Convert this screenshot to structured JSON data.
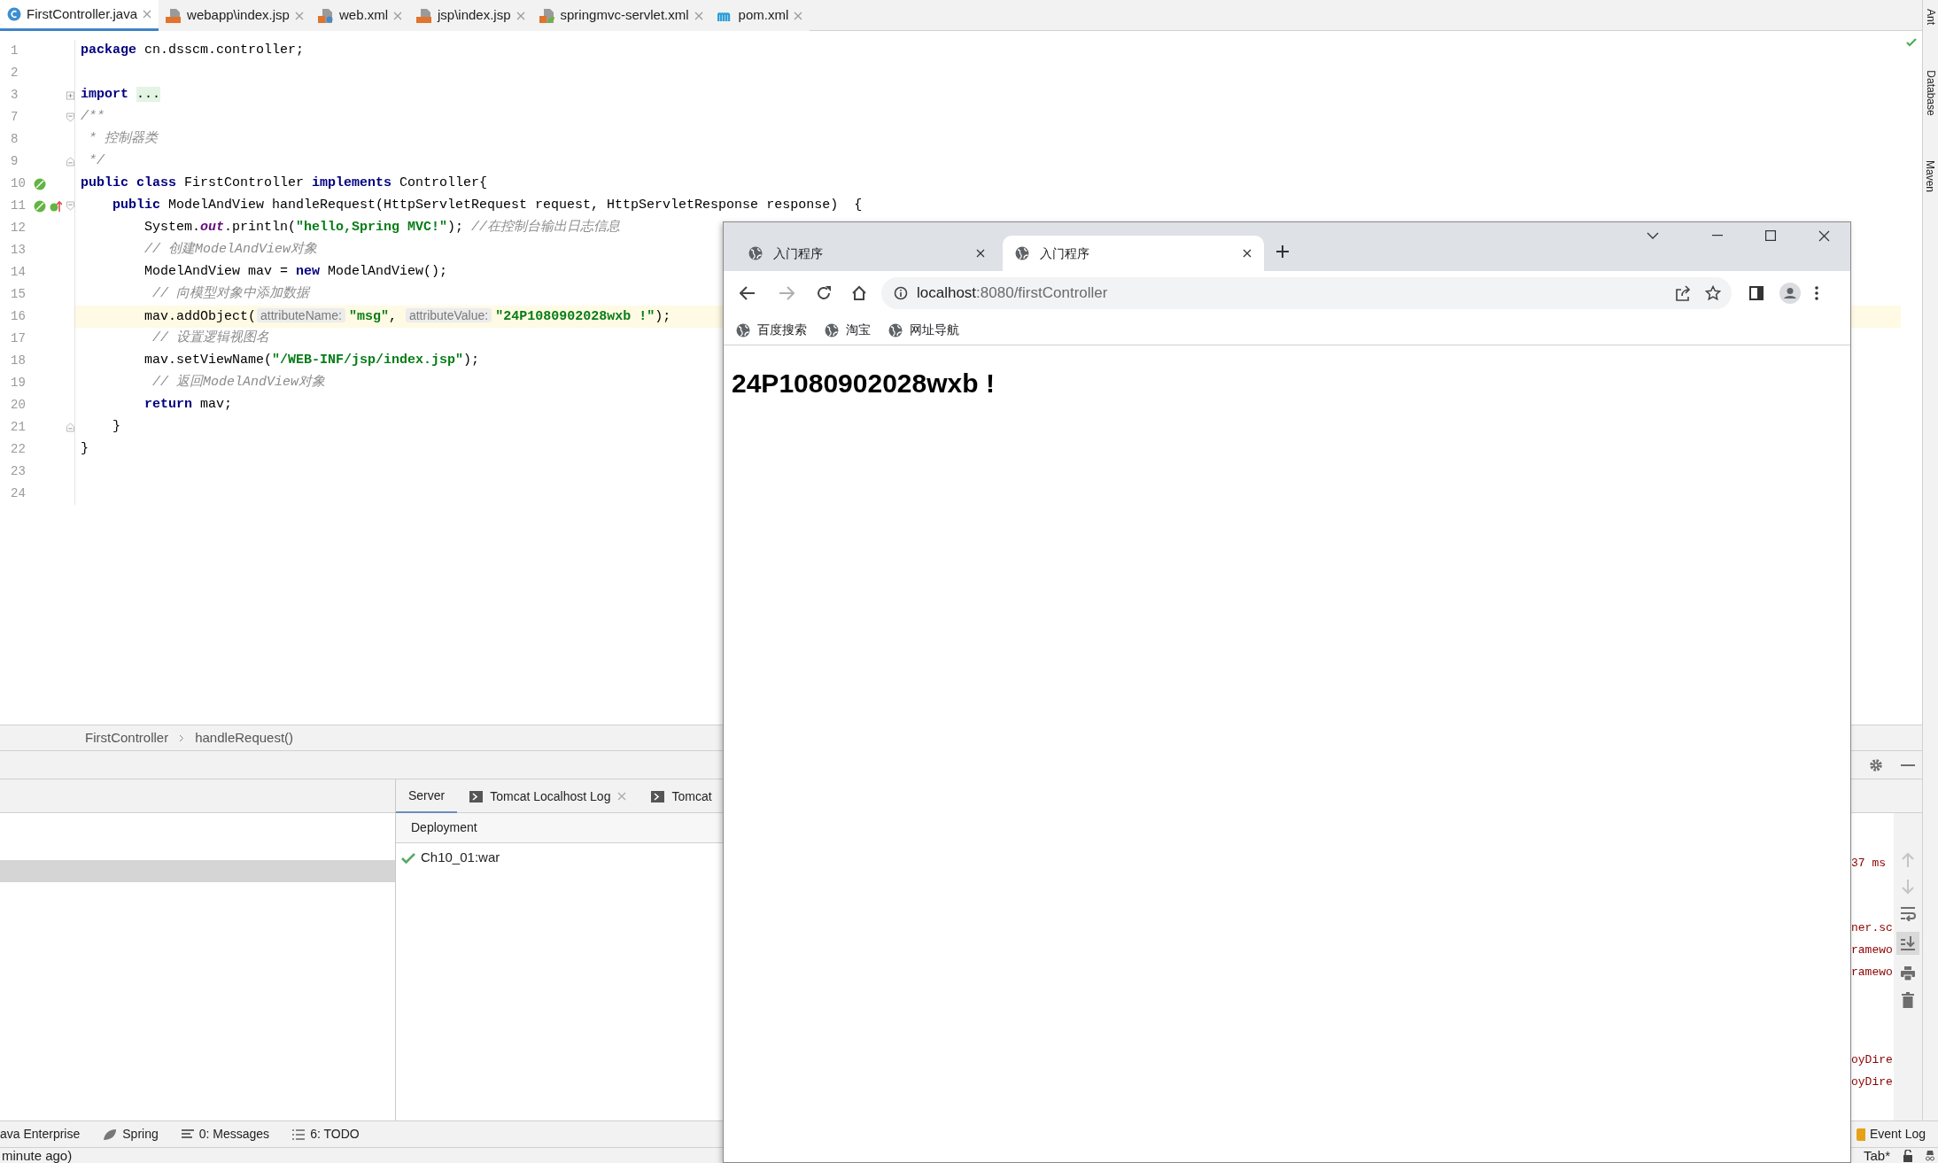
{
  "editor_tabs": [
    {
      "label": "FirstController.java",
      "kind": "class",
      "selected": true
    },
    {
      "label": "webapp\\index.jsp",
      "kind": "jsp",
      "selected": false
    },
    {
      "label": "web.xml",
      "kind": "xml",
      "selected": false
    },
    {
      "label": "jsp\\index.jsp",
      "kind": "jsp",
      "selected": false
    },
    {
      "label": "springmvc-servlet.xml",
      "kind": "spring_xml",
      "selected": false
    },
    {
      "label": "pom.xml",
      "kind": "maven",
      "selected": false
    }
  ],
  "code_lines": [
    {
      "number": "1",
      "current": false,
      "tokens": [
        {
          "kind": "kw",
          "text": "package"
        },
        {
          "kind": "plain",
          "text": " cn.dsscm.controller;"
        }
      ]
    },
    {
      "number": "2",
      "current": false
    },
    {
      "number": "3",
      "current": false,
      "fold": {
        "kind": "collapsed"
      },
      "tokens": [
        {
          "kind": "kw",
          "text": "import"
        },
        {
          "kind": "folded",
          "text": "..."
        }
      ]
    },
    {
      "number": "7",
      "current": false,
      "fold": {
        "kind": "start"
      },
      "tokens": [
        {
          "kind": "cmt",
          "text": "/**"
        }
      ]
    },
    {
      "number": "8",
      "current": false,
      "tokens": [
        {
          "kind": "cmt",
          "text": " * 控制器类"
        }
      ]
    },
    {
      "number": "9",
      "current": false,
      "fold": {
        "kind": "end"
      },
      "tokens": [
        {
          "kind": "cmt",
          "text": " */"
        }
      ]
    },
    {
      "number": "10",
      "current": false,
      "gutter": [
        {
          "kind": "bean"
        }
      ],
      "tokens": [
        {
          "kind": "kw",
          "text": "public class"
        },
        {
          "kind": "plain",
          "text": " FirstController "
        },
        {
          "kind": "kw",
          "text": "implements"
        },
        {
          "kind": "plain",
          "text": " Controller{"
        }
      ]
    },
    {
      "number": "11",
      "current": false,
      "gutter": [
        {
          "kind": "bean"
        },
        {
          "kind": "override"
        }
      ],
      "fold": {
        "kind": "start"
      },
      "tokens": [
        {
          "kind": "kw",
          "text": "    public"
        },
        {
          "kind": "plain",
          "text": " ModelAndView handleRequest(HttpServletRequest request, HttpServletResponse response)  {"
        }
      ]
    },
    {
      "number": "12",
      "current": false,
      "tokens": [
        {
          "kind": "plain",
          "text": "        System."
        },
        {
          "kind": "field",
          "text": "out"
        },
        {
          "kind": "plain",
          "text": ".println("
        },
        {
          "kind": "str",
          "text": "\"hello,Spring MVC!\""
        },
        {
          "kind": "plain",
          "text": "); "
        },
        {
          "kind": "cmt",
          "text": "//在控制台输出日志信息"
        }
      ]
    },
    {
      "number": "13",
      "current": false,
      "tokens": [
        {
          "kind": "cmt",
          "text": "        // 创建ModelAndView对象"
        }
      ]
    },
    {
      "number": "14",
      "current": false,
      "tokens": [
        {
          "kind": "plain",
          "text": "        ModelAndView mav = "
        },
        {
          "kind": "kw",
          "text": "new"
        },
        {
          "kind": "plain",
          "text": " ModelAndView();"
        }
      ]
    },
    {
      "number": "15",
      "current": false,
      "tokens": [
        {
          "kind": "cmt",
          "text": "         // 向模型对象中添加数据"
        }
      ]
    },
    {
      "number": "16",
      "current": true,
      "tokens": [
        {
          "kind": "plain",
          "text": "        mav.addObject("
        },
        {
          "kind": "hint",
          "text": "attributeName:"
        },
        {
          "kind": "str",
          "text": "\"msg\""
        },
        {
          "kind": "plain",
          "text": ", "
        },
        {
          "kind": "hint",
          "text": "attributeValue:"
        },
        {
          "kind": "str",
          "text": "\"24P1080902028wxb !\""
        },
        {
          "kind": "plain",
          "text": ");"
        }
      ]
    },
    {
      "number": "17",
      "current": false,
      "tokens": [
        {
          "kind": "cmt",
          "text": "         // 设置逻辑视图名"
        }
      ]
    },
    {
      "number": "18",
      "current": false,
      "tokens": [
        {
          "kind": "plain",
          "text": "        mav.setViewName("
        },
        {
          "kind": "str",
          "text": "\"/WEB-INF/jsp/index.jsp\""
        },
        {
          "kind": "plain",
          "text": ");"
        }
      ]
    },
    {
      "number": "19",
      "current": false,
      "tokens": [
        {
          "kind": "cmt",
          "text": "         // 返回ModelAndView对象"
        }
      ]
    },
    {
      "number": "20",
      "current": false,
      "tokens": [
        {
          "kind": "kw",
          "text": "        return"
        },
        {
          "kind": "plain",
          "text": " mav;"
        }
      ]
    },
    {
      "number": "21",
      "current": false,
      "fold": {
        "kind": "end"
      },
      "tokens": [
        {
          "kind": "plain",
          "text": "    }"
        }
      ]
    },
    {
      "number": "22",
      "current": false,
      "tokens": [
        {
          "kind": "plain",
          "text": "}"
        }
      ]
    },
    {
      "number": "23",
      "current": false
    },
    {
      "number": "24",
      "current": false
    }
  ],
  "breadcrumb": [
    "FirstController",
    "handleRequest()"
  ],
  "services_rows": [
    {
      "selected": false
    },
    {
      "selected": false
    },
    {
      "selected": true
    }
  ],
  "run_tabs": [
    {
      "label": "Server",
      "kind": "plain",
      "selected": true
    },
    {
      "label": "Tomcat Localhost Log",
      "kind": "log",
      "selected": false,
      "closable": true
    },
    {
      "label": "Tomcat",
      "kind": "log",
      "selected": false
    }
  ],
  "deployment": {
    "header": "Deployment",
    "items": [
      {
        "label": "Ch10_01:war",
        "kind": "deployed"
      }
    ]
  },
  "log_blocks": [
    [
      "37 ms"
    ],
    [
      "ner.sc",
      "ramewo",
      "ramewo"
    ],
    [
      "oyDire",
      "oyDire"
    ]
  ],
  "side_tools": [
    "Ant",
    "Database",
    "Maven"
  ],
  "tool_strip": [
    {
      "label": "ava Enterprise",
      "kind": "none"
    },
    {
      "label": "Spring",
      "kind": "spring"
    },
    {
      "label": "0: Messages",
      "kind": "messages"
    },
    {
      "label": "6: TODO",
      "kind": "todo"
    }
  ],
  "event_log": "Event Log",
  "status_bar": {
    "message": "minute ago)",
    "indent": "Tab*"
  },
  "browser": {
    "tabs": [
      {
        "title": "入门程序",
        "selected": false
      },
      {
        "title": "入门程序",
        "selected": true
      }
    ],
    "url_host": "localhost",
    "url_rest": ":8080/firstController",
    "bookmarks": [
      "百度搜索",
      "淘宝",
      "网址导航"
    ],
    "heading": "24P1080902028wxb !"
  }
}
